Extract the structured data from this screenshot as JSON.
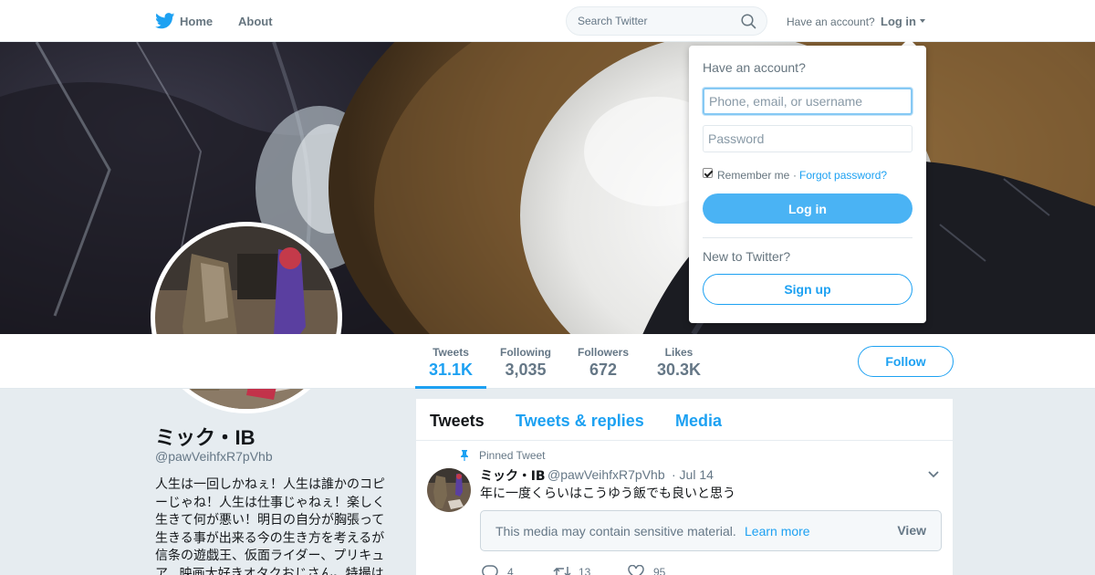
{
  "nav": {
    "home_label": "Home",
    "about_label": "About",
    "search_placeholder": "Search Twitter",
    "have_account": "Have an account?",
    "login_label": "Log in"
  },
  "profile": {
    "display_name": "ミック・IB",
    "screen_name": "@pawVeihfxR7pVhb",
    "bio": "人生は一回しかねぇ！人生は誰かのコピーじゃね！人生は仕事じゃねぇ！楽しく生きて何が悪い！明日の自分が胸張って生きる事が出来る今の生き方を考えるが信条の遊戯王、仮面ライダー、プリキュア、映画大好きオタクおじさん。特撮は"
  },
  "stats": [
    {
      "label": "Tweets",
      "value": "31.1K",
      "active": true
    },
    {
      "label": "Following",
      "value": "3,035",
      "active": false
    },
    {
      "label": "Followers",
      "value": "672",
      "active": false
    },
    {
      "label": "Likes",
      "value": "30.3K",
      "active": false
    }
  ],
  "follow_label": "Follow",
  "timeline": {
    "tabs": [
      "Tweets",
      "Tweets & replies",
      "Media"
    ],
    "pinned_label": "Pinned Tweet",
    "tweet": {
      "name": "ミック・IB",
      "handle": "@pawVeihfxR7pVhb",
      "time": "· Jul 14",
      "text": "年に一度くらいはこうゆう飯でも良いと思う",
      "sensitive_text": "This media may contain sensitive material.",
      "learn_more": "Learn more",
      "view_label": "View",
      "replies": "4",
      "retweets": "13",
      "likes": "95"
    }
  },
  "login_dropdown": {
    "title": "Have an account?",
    "username_placeholder": "Phone, email, or username",
    "password_placeholder": "Password",
    "remember_label": "Remember me",
    "separator": "·",
    "forgot_label": "Forgot password?",
    "login_button": "Log in",
    "new_label": "New to Twitter?",
    "signup_button": "Sign up"
  },
  "colors": {
    "accent": "#1da1f2",
    "login_button": "#4ab3f4",
    "background": "#e6ecf0"
  }
}
